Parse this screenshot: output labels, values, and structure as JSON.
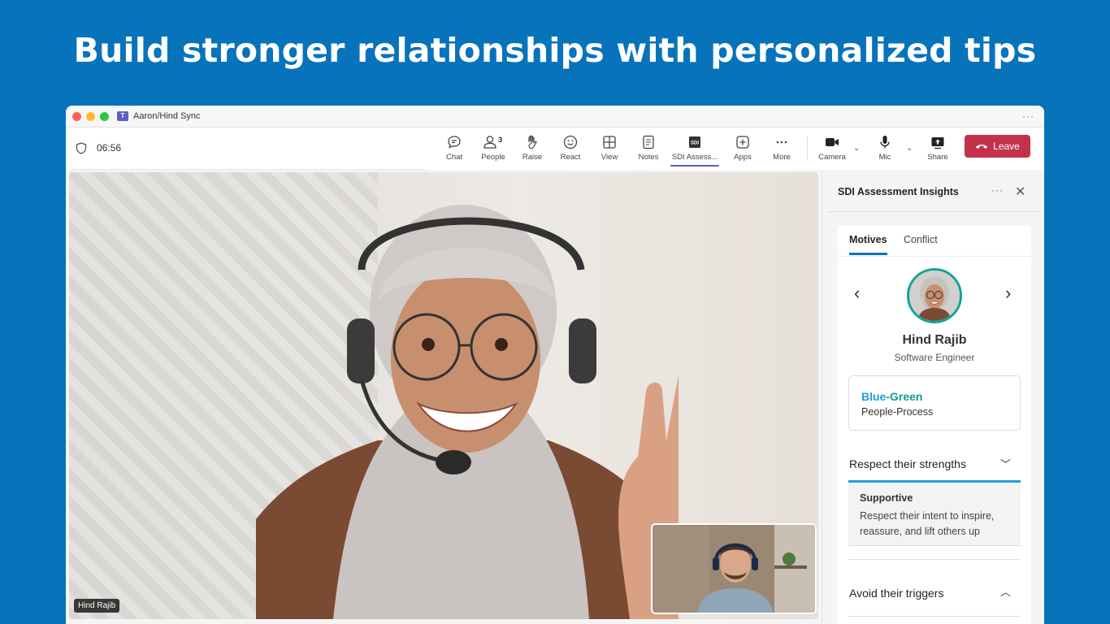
{
  "headline": "Build stronger relationships with personalized tips",
  "window": {
    "title": "Aaron/Hind Sync",
    "more": "···"
  },
  "toolbar": {
    "timer": "06:56",
    "people_count": "3",
    "buttons": [
      {
        "label": "Chat",
        "icon": "chat-icon"
      },
      {
        "label": "People",
        "icon": "people-icon"
      },
      {
        "label": "Raise",
        "icon": "hand-icon"
      },
      {
        "label": "React",
        "icon": "smile-icon"
      },
      {
        "label": "View",
        "icon": "grid-icon"
      },
      {
        "label": "Notes",
        "icon": "notes-icon"
      },
      {
        "label": "SDI Assess...",
        "icon": "sdi-icon"
      },
      {
        "label": "Apps",
        "icon": "plus-icon"
      },
      {
        "label": "More",
        "icon": "more-icon"
      },
      {
        "label": "Camera",
        "icon": "camera-icon"
      },
      {
        "label": "Mic",
        "icon": "mic-icon"
      },
      {
        "label": "Share",
        "icon": "share-icon"
      }
    ],
    "leave_label": "Leave"
  },
  "video": {
    "name_tag": "Hind Rajib"
  },
  "panel": {
    "title": "SDI Assessment Insights",
    "more": "···",
    "tabs": [
      {
        "label": "Motives"
      },
      {
        "label": "Conflict"
      }
    ],
    "person": {
      "name": "Hind Rajib",
      "role": "Software Engineer"
    },
    "style": {
      "part1": "Blue",
      "sep": "-",
      "part2": "Green",
      "sub": "People-Process"
    },
    "sections": [
      {
        "title": "Respect their strengths",
        "expanded": true,
        "tip_title": "Supportive",
        "tip_text": "Respect their intent to inspire, reassure, and lift others up"
      },
      {
        "title": "Avoid their triggers",
        "expanded": false
      }
    ],
    "colors": {
      "accent": "#1da1d8",
      "green": "#10a08a",
      "leave": "#c4314b"
    }
  }
}
